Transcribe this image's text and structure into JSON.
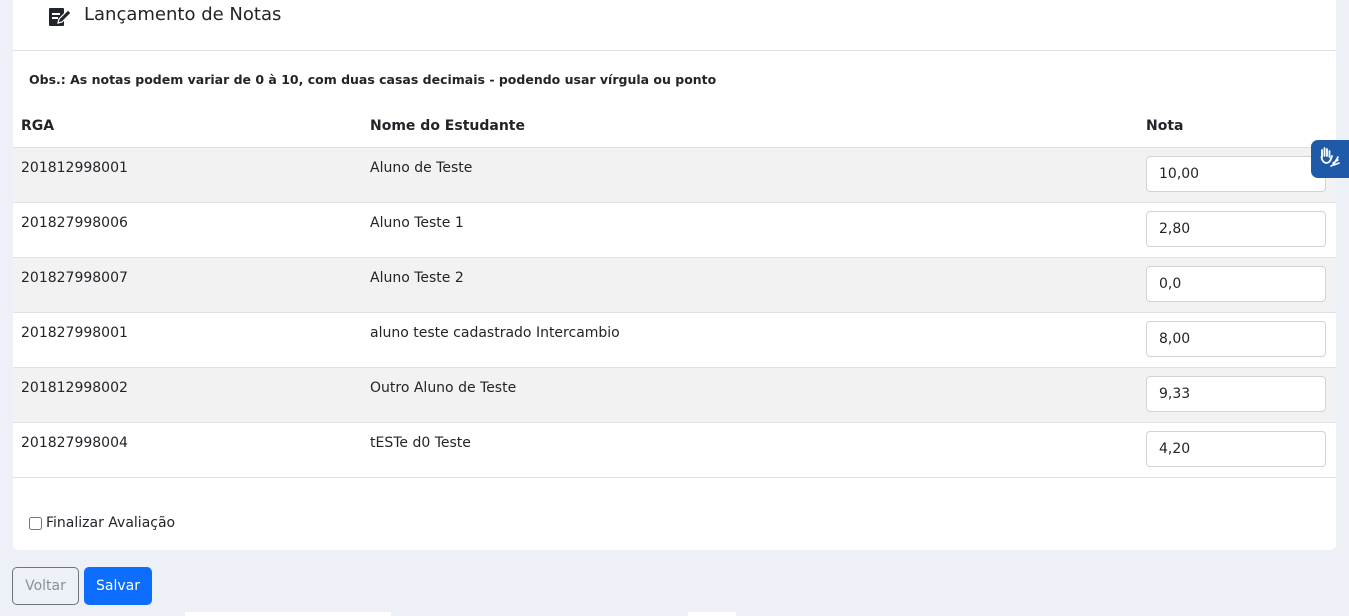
{
  "header": {
    "title": "Lançamento de Notas",
    "icon": "edit-note-icon"
  },
  "obs": "Obs.: As notas podem variar de 0 à 10, com duas casas decimais - podendo usar vírgula ou ponto",
  "table": {
    "columns": [
      "RGA",
      "Nome do Estudante",
      "Nota"
    ],
    "rows": [
      {
        "rga": "201812998001",
        "nome": "Aluno de Teste",
        "nota": "10,00"
      },
      {
        "rga": "201827998006",
        "nome": "Aluno Teste 1",
        "nota": "2,80"
      },
      {
        "rga": "201827998007",
        "nome": "Aluno Teste 2",
        "nota": "0,0"
      },
      {
        "rga": "201827998001",
        "nome": "aluno teste cadastrado Intercambio",
        "nota": "8,00"
      },
      {
        "rga": "201812998002",
        "nome": "Outro Aluno de Teste",
        "nota": "9,33"
      },
      {
        "rga": "201827998004",
        "nome": "tESTe d0 Teste",
        "nota": "4,20"
      }
    ]
  },
  "finalizar": {
    "label": "Finalizar Avaliação",
    "checked": false
  },
  "buttons": {
    "voltar": "Voltar",
    "salvar": "Salvar"
  },
  "accessibility_widget": {
    "icon": "sign-language-hands-icon"
  },
  "colors": {
    "primary": "#0d6efd",
    "background": "#edf0f7",
    "stripe": "#f2f2f2",
    "vlibras": "#1e5aa8"
  }
}
